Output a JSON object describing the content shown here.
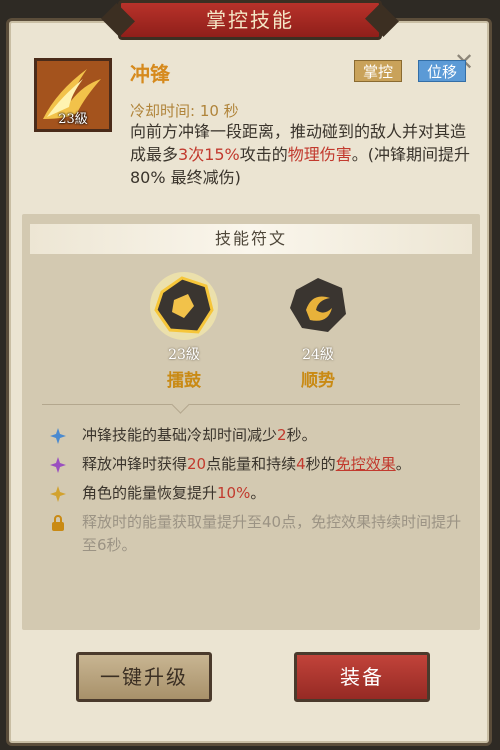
{
  "header": {
    "title": "掌控技能"
  },
  "skill": {
    "name": "冲锋",
    "level": "23級",
    "tags": [
      "掌控",
      "位移"
    ],
    "cooldown": "冷却时间: 10 秒",
    "desc_part1": "向前方冲锋一段距离，推动碰到的敌人并对其造成最多",
    "desc_hl1": "3次15%",
    "desc_part2": "攻击的",
    "desc_hl2": "物理伤害",
    "desc_part3": "。(冲锋期间提升 80% 最终减伤)"
  },
  "runes": {
    "header": "技能符文",
    "items": [
      {
        "level": "23級",
        "name": "擂鼓"
      },
      {
        "level": "24級",
        "name": "顺势"
      }
    ]
  },
  "effects": [
    {
      "icon": "blue-diamond-icon",
      "color": "#4a8ad0",
      "p1": "冲锋技能的基础冷却时间减少",
      "h1": "2",
      "p2": "秒。",
      "h2": "",
      "p3": ""
    },
    {
      "icon": "purple-diamond-icon",
      "color": "#9a4fc0",
      "p1": "释放冲锋时获得",
      "h1": "20",
      "p2": "点能量和持续",
      "h2": "4",
      "p3": "秒的"
    },
    {
      "icon": "gold-diamond-icon",
      "color": "#d2a22e",
      "p1": "角色的能量恢复提升",
      "h1": "10%",
      "p2": "。",
      "h2": "",
      "p3": ""
    }
  ],
  "effect2_link": "免控效果",
  "effect2_end": "。",
  "locked_effect": {
    "icon": "lock-icon",
    "text": "释放时的能量获取量提升至40点，免控效果持续时间提升至6秒。"
  },
  "buttons": {
    "upgrade": "一键升级",
    "equip": "装备"
  },
  "colors": {
    "accent": "#c23a2e",
    "rune_name": "#c98a14"
  }
}
